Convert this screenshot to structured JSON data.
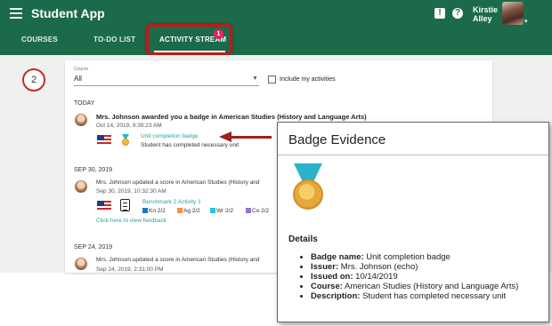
{
  "header": {
    "app_title": "Student App",
    "user_name_line1": "Kirstie",
    "user_name_line2": "Alley",
    "alert_icon_glyph": "!",
    "help_icon_glyph": "?",
    "brand_color": "#1b6b4a"
  },
  "tabs": [
    {
      "label": "COURSES",
      "active": false
    },
    {
      "label": "TO-DO LIST",
      "active": false
    },
    {
      "label": "ACTIVITY STREAM",
      "active": true,
      "badge": "1"
    }
  ],
  "annotation": {
    "step_number": "2",
    "highlight_color": "#c3161c"
  },
  "filters": {
    "course_label": "Course",
    "course_value": "All",
    "include_my_activities_label": "Include my activities",
    "include_my_activities_checked": false
  },
  "stream": {
    "today": {
      "heading": "TODAY",
      "item": {
        "title": "Mrs. Johnson awarded you a badge in American Studies (History and Language Arts)",
        "date": "Oct 14, 2019, 9:39:23 AM",
        "badge_name": "Unit completion badge",
        "badge_desc": "Student has completed necessary unit"
      }
    },
    "sep30": {
      "heading": "SEP 30, 2019",
      "item": {
        "title": "Mrs. Johnson updated a score in American Studies (History and",
        "date": "Sep 30, 2019, 10:32:30 AM",
        "assignment": "Benchmark 2 Activity 1",
        "scores": [
          {
            "label": "Kn 2/2",
            "color": "#1976d2"
          },
          {
            "label": "Ag 2/2",
            "color": "#fb8c3c"
          },
          {
            "label": "Wr 2/2",
            "color": "#26c6da"
          },
          {
            "label": "Co 2/2",
            "color": "#9575cd"
          }
        ],
        "feedback_link": "Click here to view feedback"
      }
    },
    "sep24": {
      "heading": "SEP 24, 2019",
      "item": {
        "title": "Mrs. Johnson updated a score in American Studies (History and",
        "date": "Sep 24, 2019, 2:31:00 PM"
      }
    }
  },
  "popup": {
    "title": "Badge Evidence",
    "details_heading": "Details",
    "fields": [
      {
        "label": "Badge name:",
        "value": " Unit completion badge"
      },
      {
        "label": "Issuer:",
        "value": " Mrs. Johnson (echo)"
      },
      {
        "label": "Issued on:",
        "value": " 10/14/2019"
      },
      {
        "label": "Course:",
        "value": " American Studies (History and Language Arts)"
      },
      {
        "label": "Description:",
        "value": " Student has completed necessary unit"
      }
    ]
  }
}
